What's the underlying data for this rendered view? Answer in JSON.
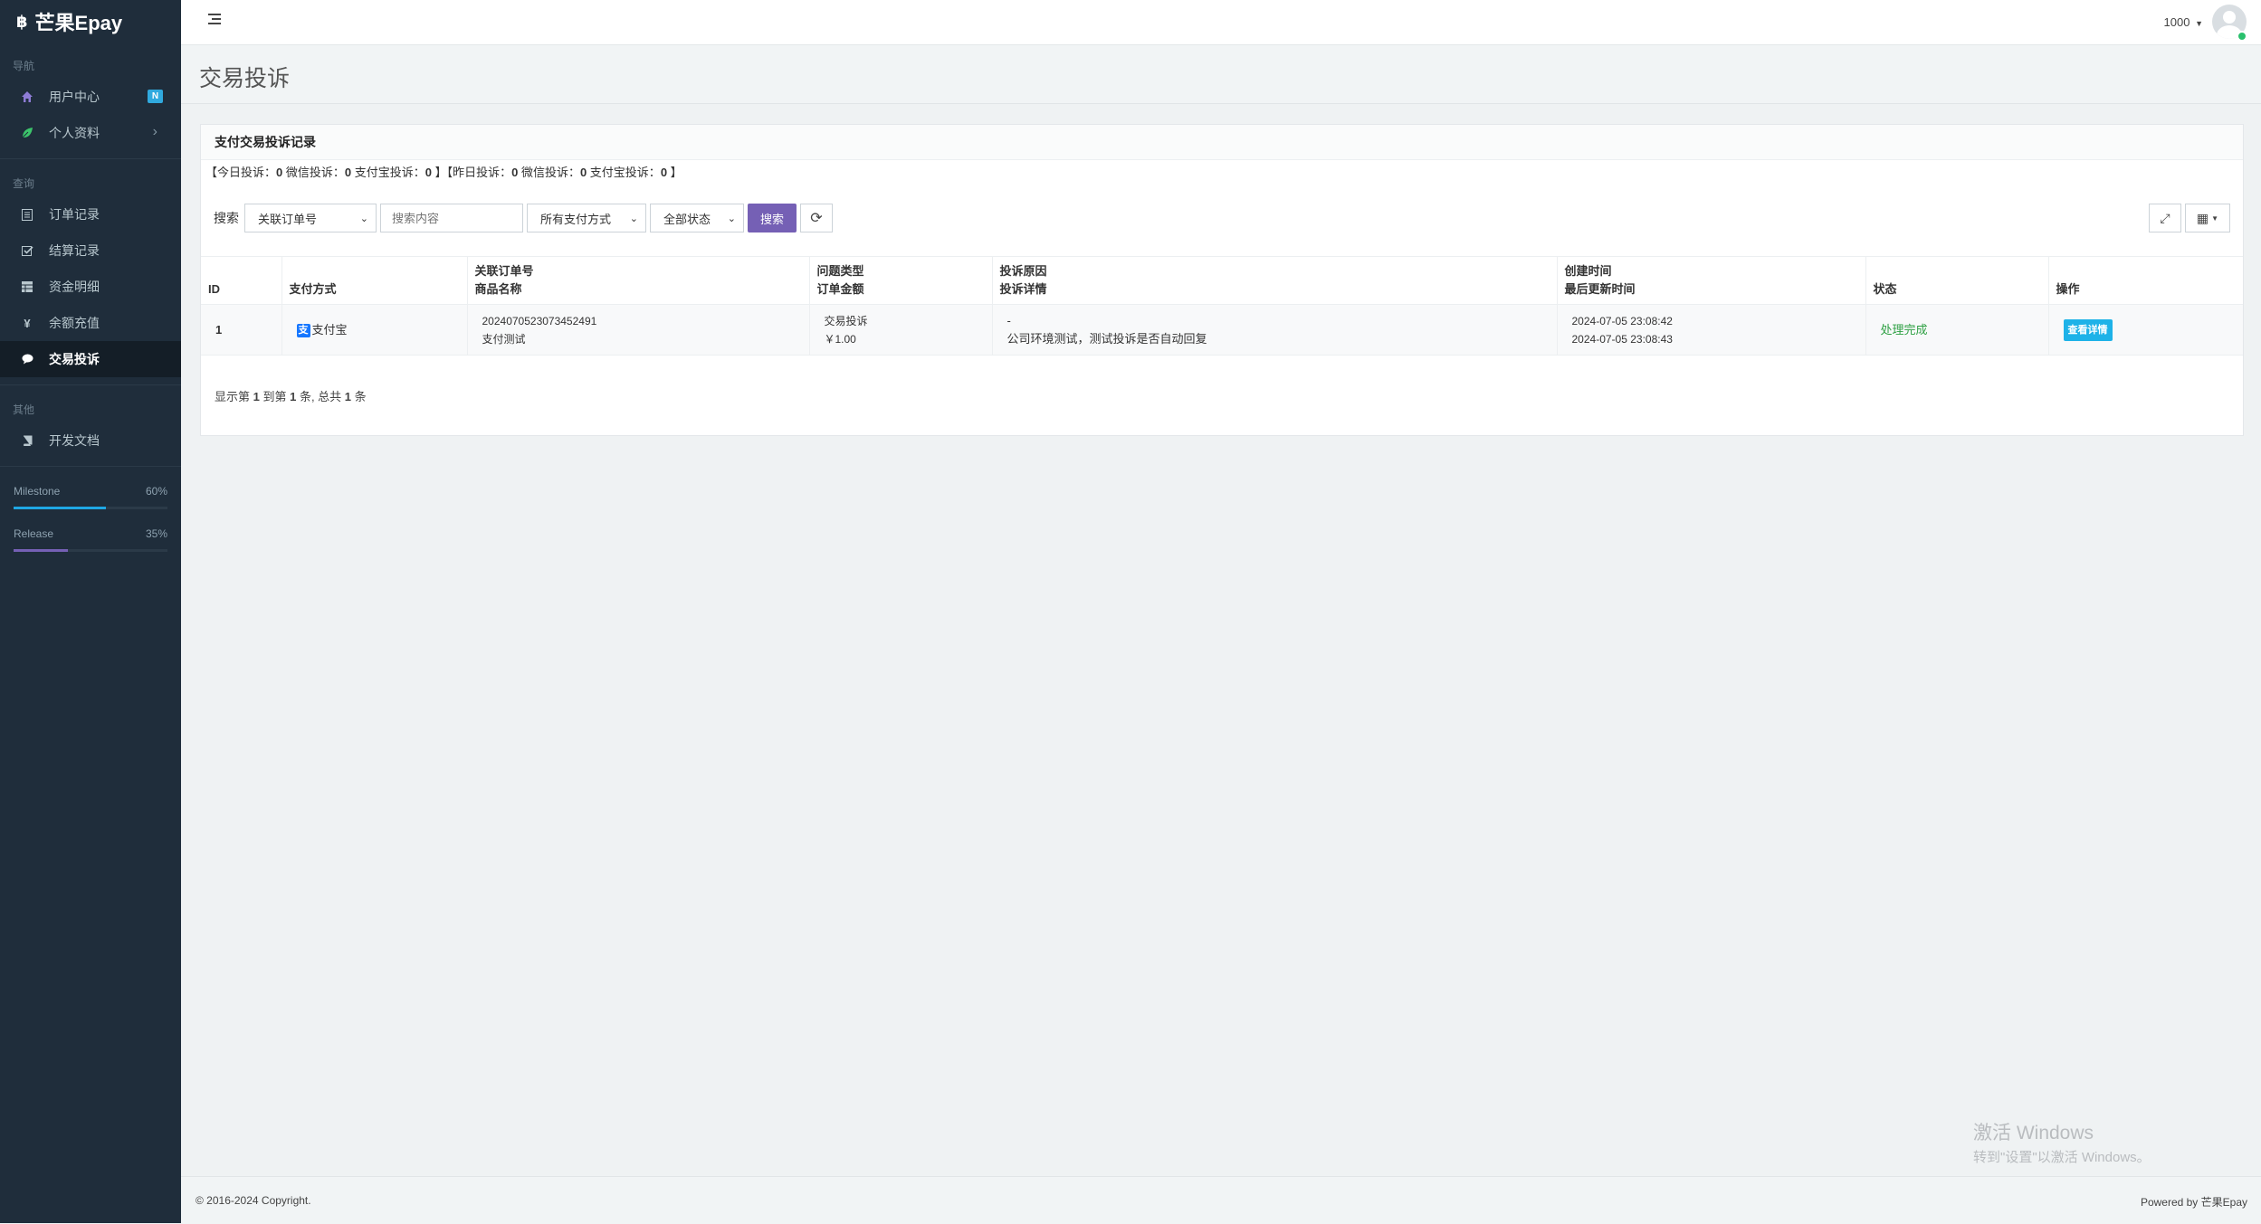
{
  "sidebar": {
    "brand": "芒果Epay",
    "brand_icon": "฿",
    "sections": [
      {
        "header": "导航",
        "items": [
          {
            "label": "用户中心",
            "icon": "home-icon",
            "badge": "N"
          },
          {
            "label": "个人资料",
            "icon": "leaf-icon"
          }
        ]
      },
      {
        "header": "查询",
        "items": [
          {
            "label": "订单记录",
            "icon": "list-icon"
          },
          {
            "label": "结算记录",
            "icon": "check-square-icon"
          },
          {
            "label": "资金明细",
            "icon": "table-icon"
          },
          {
            "label": "余额充值",
            "icon": "yen-icon"
          },
          {
            "label": "交易投诉",
            "icon": "comment-icon",
            "active": true
          }
        ]
      },
      {
        "header": "其他",
        "items": [
          {
            "label": "开发文档",
            "icon": "book-icon"
          }
        ]
      }
    ],
    "progress": [
      {
        "label": "Milestone",
        "value": "60%",
        "fraction": 0.6,
        "color": "#1fa7e4"
      },
      {
        "label": "Release",
        "value": "35%",
        "fraction": 0.35,
        "color": "#7560b5"
      }
    ]
  },
  "topbar": {
    "user": "1000"
  },
  "page": {
    "title": "交易投诉"
  },
  "panel": {
    "title": "支付交易投诉记录",
    "stats": {
      "today_label": "【今日投诉：",
      "today_value": "0",
      "today_wx_label": " 微信投诉：",
      "today_wx_value": "0",
      "today_ali_label": " 支付宝投诉：",
      "today_ali_value": "0",
      "mid": " 】【昨日投诉：",
      "yday_value": "0",
      "yday_wx_label": " 微信投诉：",
      "yday_wx_value": "0",
      "yday_ali_label": " 支付宝投诉：",
      "yday_ali_value": "0",
      "end": " 】"
    },
    "search": {
      "label": "搜索",
      "field_select": "关联订单号",
      "placeholder": "搜索内容",
      "pay_select": "所有支付方式",
      "status_select": "全部状态",
      "search_button": "搜索"
    },
    "table": {
      "headers": [
        {
          "l1": "",
          "l2": "ID"
        },
        {
          "l1": "",
          "l2": "支付方式"
        },
        {
          "l1": "关联订单号",
          "l2": "商品名称"
        },
        {
          "l1": "问题类型",
          "l2": "订单金额"
        },
        {
          "l1": "投诉原因",
          "l2": "投诉详情"
        },
        {
          "l1": "创建时间",
          "l2": "最后更新时间"
        },
        {
          "l1": "",
          "l2": "状态"
        },
        {
          "l1": "",
          "l2": "操作"
        }
      ],
      "rows": [
        {
          "id": "1",
          "pay_method": "支付宝",
          "pay_icon": "支",
          "order_no": "2024070523073452491",
          "product": "支付测试",
          "type": "交易投诉",
          "amount": "￥1.00",
          "reason": "-",
          "detail": "公司环境测试，测试投诉是否自动回复",
          "created": "2024-07-05 23:08:42",
          "updated": "2024-07-05 23:08:43",
          "status": "处理完成",
          "action": "查看详情"
        }
      ]
    },
    "pagination": {
      "prefix": "显示第 ",
      "from": "1",
      "mid1": " 到第 ",
      "to": "1",
      "mid2": " 条, 总共 ",
      "total": "1",
      "suffix": " 条"
    }
  },
  "footer": {
    "copyright": "© 2016-2024 Copyright.",
    "powered": "Powered by 芒果Epay"
  },
  "watermark": {
    "line1": "激活 Windows",
    "line2": "转到\"设置\"以激活 Windows。"
  }
}
